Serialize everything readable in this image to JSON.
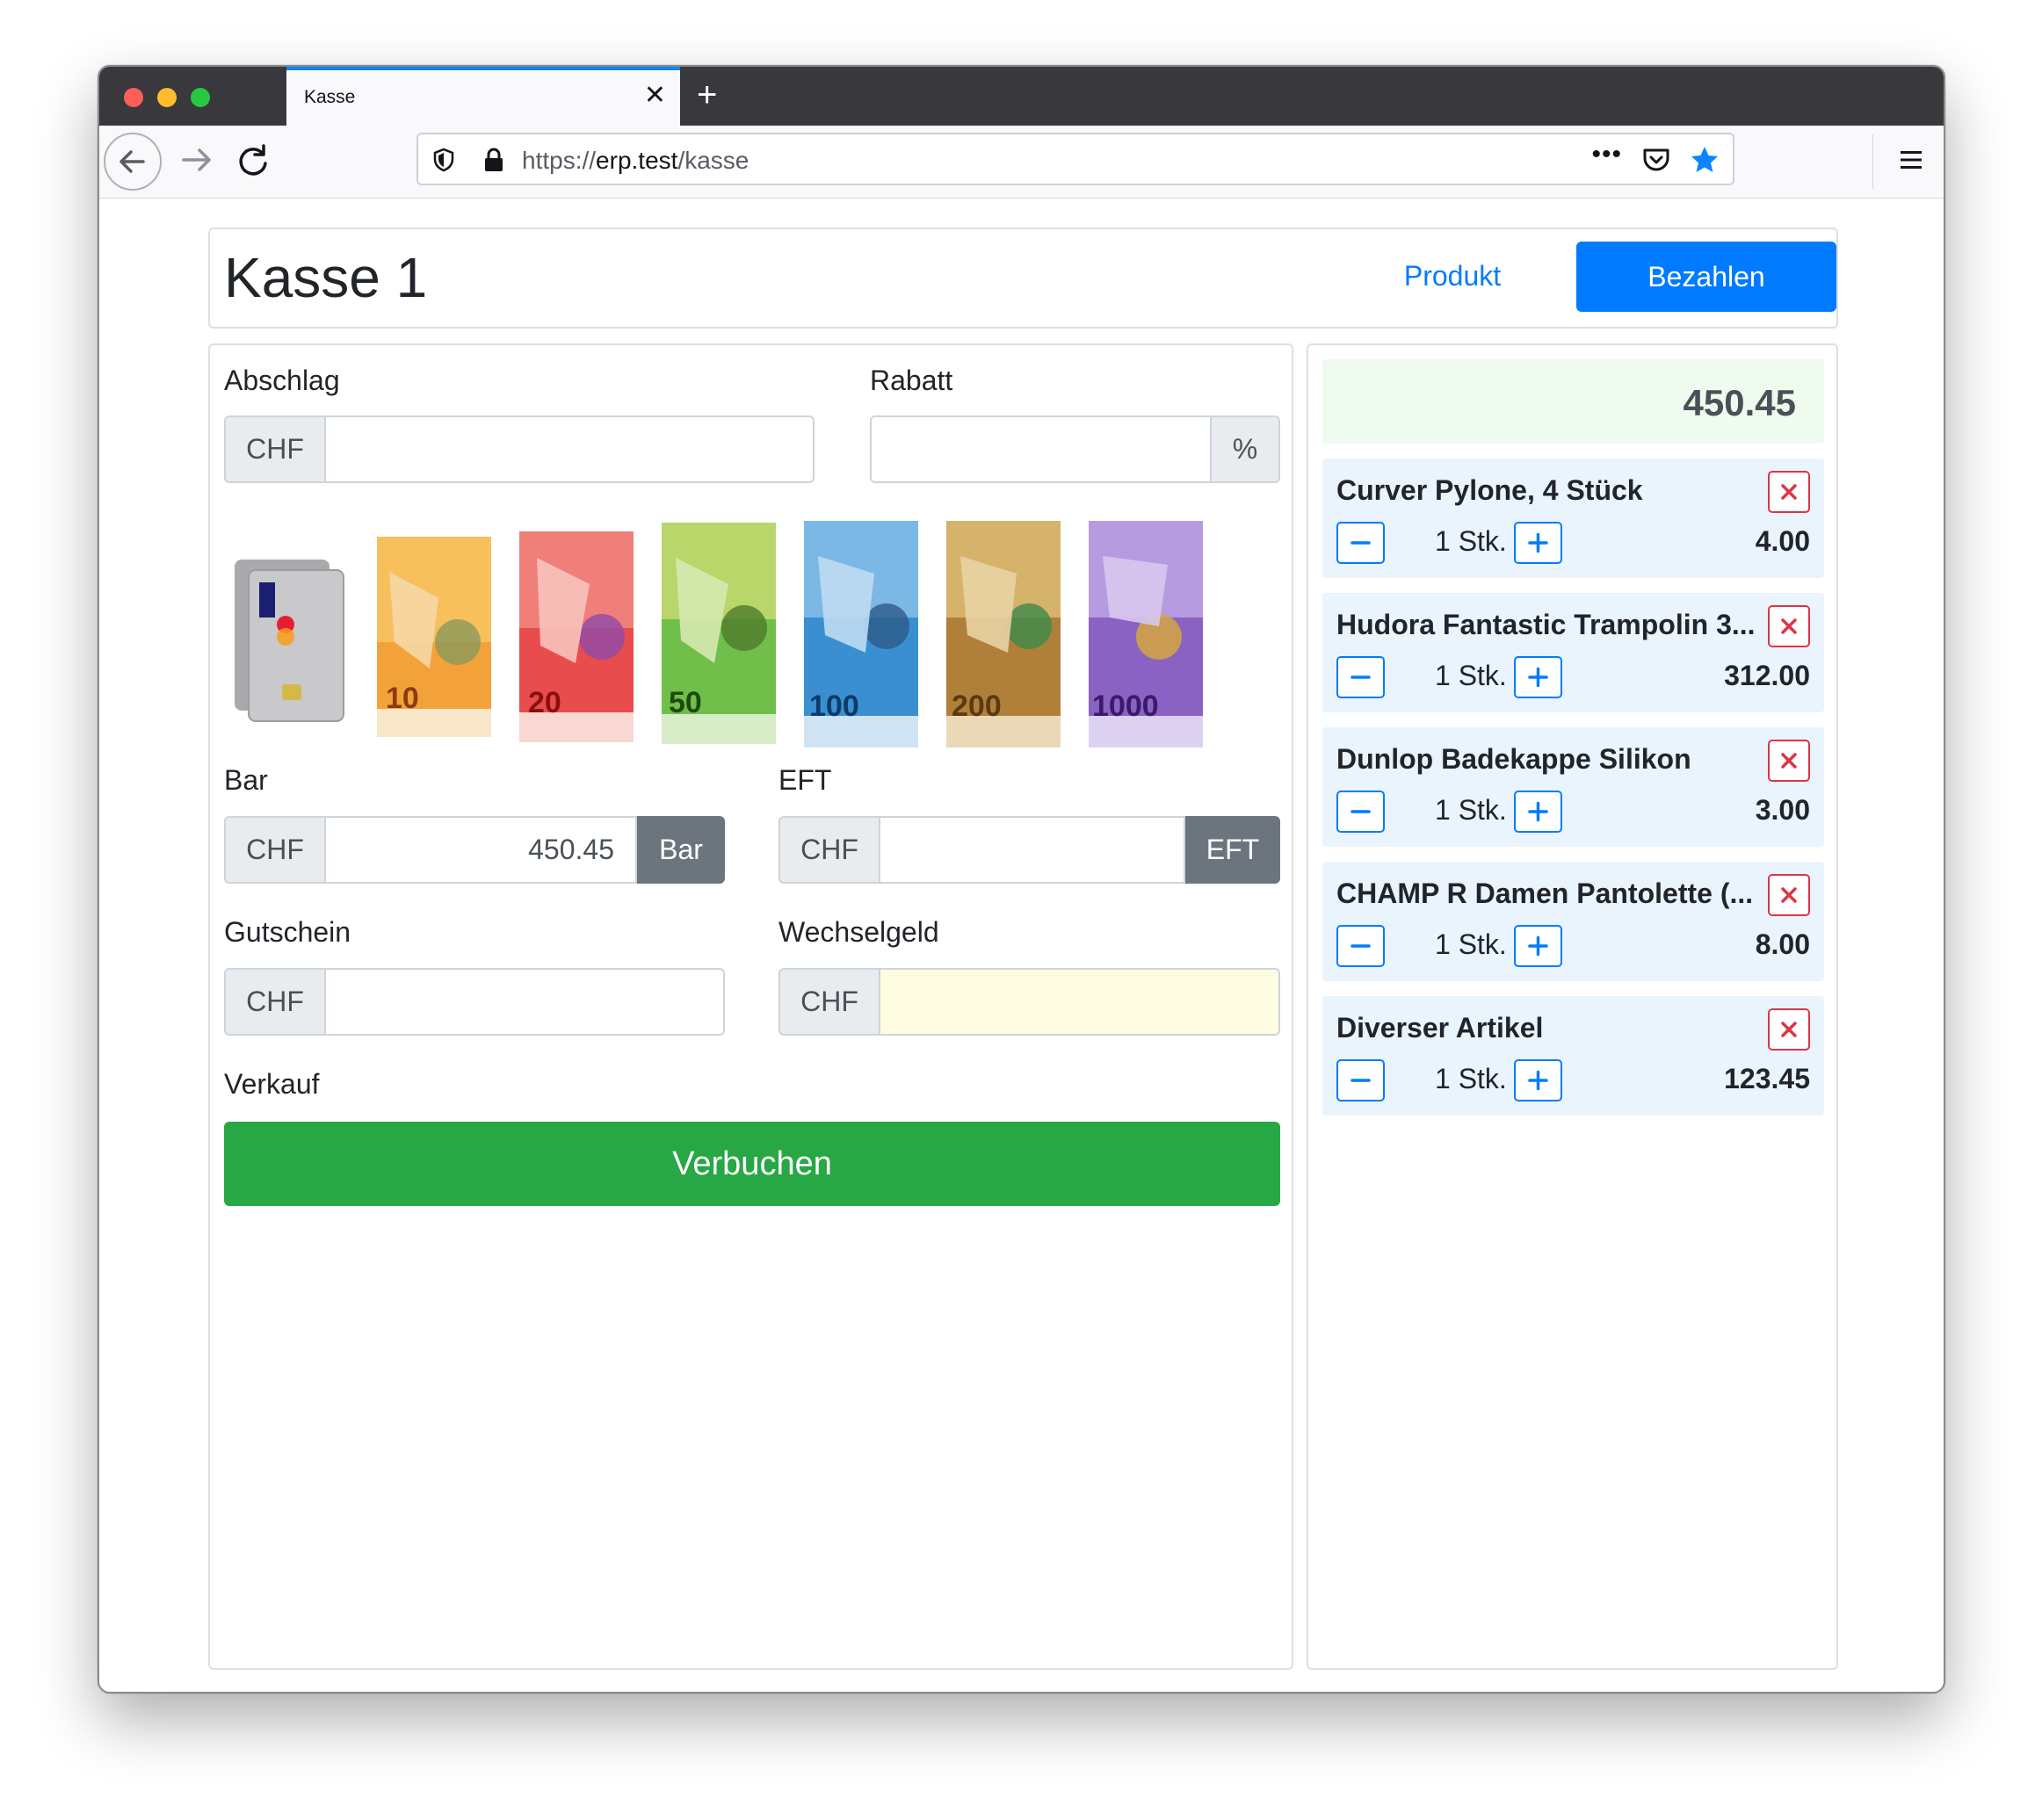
{
  "browser": {
    "tab_title": "Kasse",
    "url_scheme": "https://",
    "url_host": "erp.test",
    "url_path": "/kasse"
  },
  "header": {
    "title": "Kasse 1",
    "produkt_label": "Produkt",
    "bezahlen_label": "Bezahlen"
  },
  "form": {
    "abschlag": {
      "label": "Abschlag",
      "currency": "CHF",
      "value": ""
    },
    "rabatt": {
      "label": "Rabatt",
      "suffix": "%",
      "value": ""
    },
    "money": [
      "card",
      "10",
      "20",
      "50",
      "100",
      "200",
      "1000"
    ],
    "bar": {
      "label": "Bar",
      "currency": "CHF",
      "value": "450.45",
      "button": "Bar"
    },
    "eft": {
      "label": "EFT",
      "currency": "CHF",
      "value": "",
      "button": "EFT"
    },
    "gutschein": {
      "label": "Gutschein",
      "currency": "CHF",
      "value": ""
    },
    "wechselgeld": {
      "label": "Wechselgeld",
      "currency": "CHF",
      "value": ""
    },
    "verkauf_label": "Verkauf",
    "verbuchen_label": "Verbuchen"
  },
  "cart": {
    "total": "450.45",
    "items": [
      {
        "name": "Curver Pylone, 4 Stück",
        "qty": "1 Stk.",
        "price": "4.00"
      },
      {
        "name": "Hudora Fantastic Trampolin 3...",
        "qty": "1 Stk.",
        "price": "312.00"
      },
      {
        "name": "Dunlop Badekappe Silikon",
        "qty": "1 Stk.",
        "price": "3.00"
      },
      {
        "name": "CHAMP R Damen Pantolette (...",
        "qty": "1 Stk.",
        "price": "8.00"
      },
      {
        "name": "Diverser Artikel",
        "qty": "1 Stk.",
        "price": "123.45"
      }
    ]
  },
  "colors": {
    "primary": "#007bff",
    "success": "#28a745",
    "secondary": "#6c757d",
    "danger": "#dc3545",
    "total_bg": "#eefbee",
    "item_bg": "#eaf4fd",
    "change_bg": "#fffde1"
  }
}
